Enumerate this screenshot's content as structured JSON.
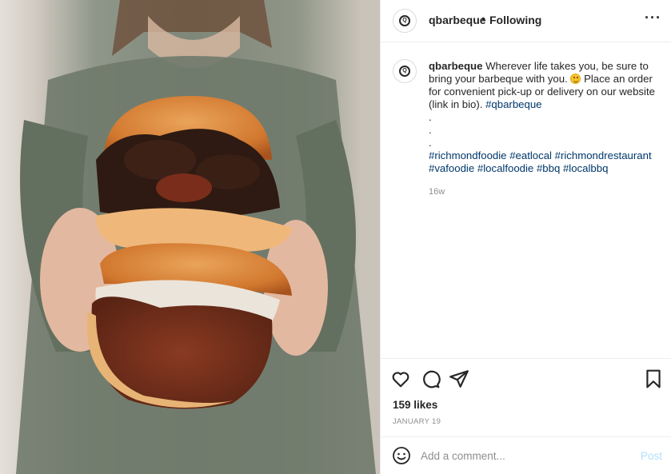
{
  "post": {
    "photo_subject": "pulled-pork-and-brisket-sandwiches-photo",
    "header": {
      "username": "qbarbeque",
      "separator": "•",
      "follow_status": "Following",
      "more_icon": "more-options-icon",
      "more_glyph": "···"
    },
    "avatar": {
      "glyph": "Q",
      "icon": "qbarbeque-logo-avatar"
    },
    "caption": {
      "username": "qbarbeque",
      "text_1": " Wherever life takes you, be sure to bring your barbeque with you. ",
      "emoji": "slightly-smiling-face-emoji",
      "text_2": " Place an order for convenient pick-up or delivery on our website (link in bio). ",
      "hashtag_1": "#qbarbeque",
      "dot_1": ".",
      "dot_2": ".",
      "dot_3": ".",
      "hashtags": [
        "#richmondfoodie",
        "#eatlocal",
        "#richmondrestaurant",
        "#vafoodie",
        "#localfoodie",
        "#bbq",
        "#localbbq"
      ],
      "time_ago": "16w"
    },
    "actions": {
      "like_icon": "heart-icon",
      "comment_icon": "comment-bubble-icon",
      "share_icon": "paper-plane-share-icon",
      "save_icon": "bookmark-icon",
      "likes_text": "159 likes",
      "date_text": "JANUARY 19"
    },
    "comment_box": {
      "emoji_icon": "smiley-face-icon",
      "placeholder": "Add a comment...",
      "post_label": "Post"
    }
  },
  "colors": {
    "text": "#262626",
    "secondary_text": "#8e8e8e",
    "hashtag": "#00376b",
    "post_button_disabled": "#b2dffc",
    "divider": "#efefef"
  }
}
